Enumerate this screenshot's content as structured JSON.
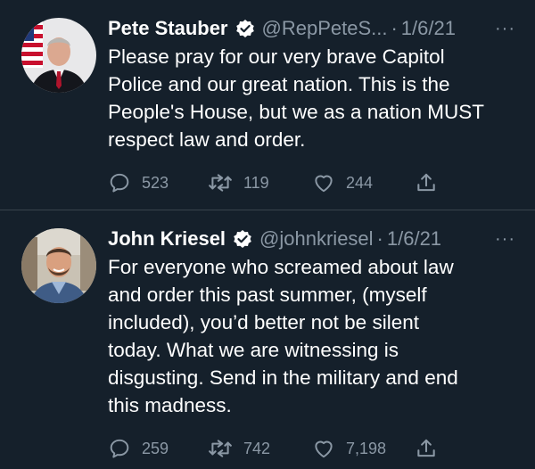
{
  "tweets": [
    {
      "name": "Pete Stauber",
      "handle": "@RepPeteS...",
      "separator": "·",
      "date": "1/6/21",
      "more": "···",
      "text": "Please pray for our very brave Capitol\nPolice and our great nation. This is the\nPeople's House, but we as a nation MUST\nrespect law and order.",
      "replies": "523",
      "retweets": "119",
      "likes": "244",
      "avatar_icon": "avatar-with-flag-icon"
    },
    {
      "name": "John Kriesel",
      "handle": "@johnkriesel",
      "separator": "·",
      "date": "1/6/21",
      "more": "···",
      "text": "For everyone who screamed about law\nand order this past summer, (myself\nincluded), you’d better not be silent\ntoday. What we are witnessing is\ndisgusting. Send in the military and end\nthis madness.",
      "replies": "259",
      "retweets": "742",
      "likes": "7,198",
      "avatar_icon": "avatar-outdoor-icon"
    }
  ],
  "colors": {
    "background": "#15202b",
    "divider": "#38444d",
    "secondary_text": "#8b98a5",
    "primary_text": "#ffffff"
  }
}
